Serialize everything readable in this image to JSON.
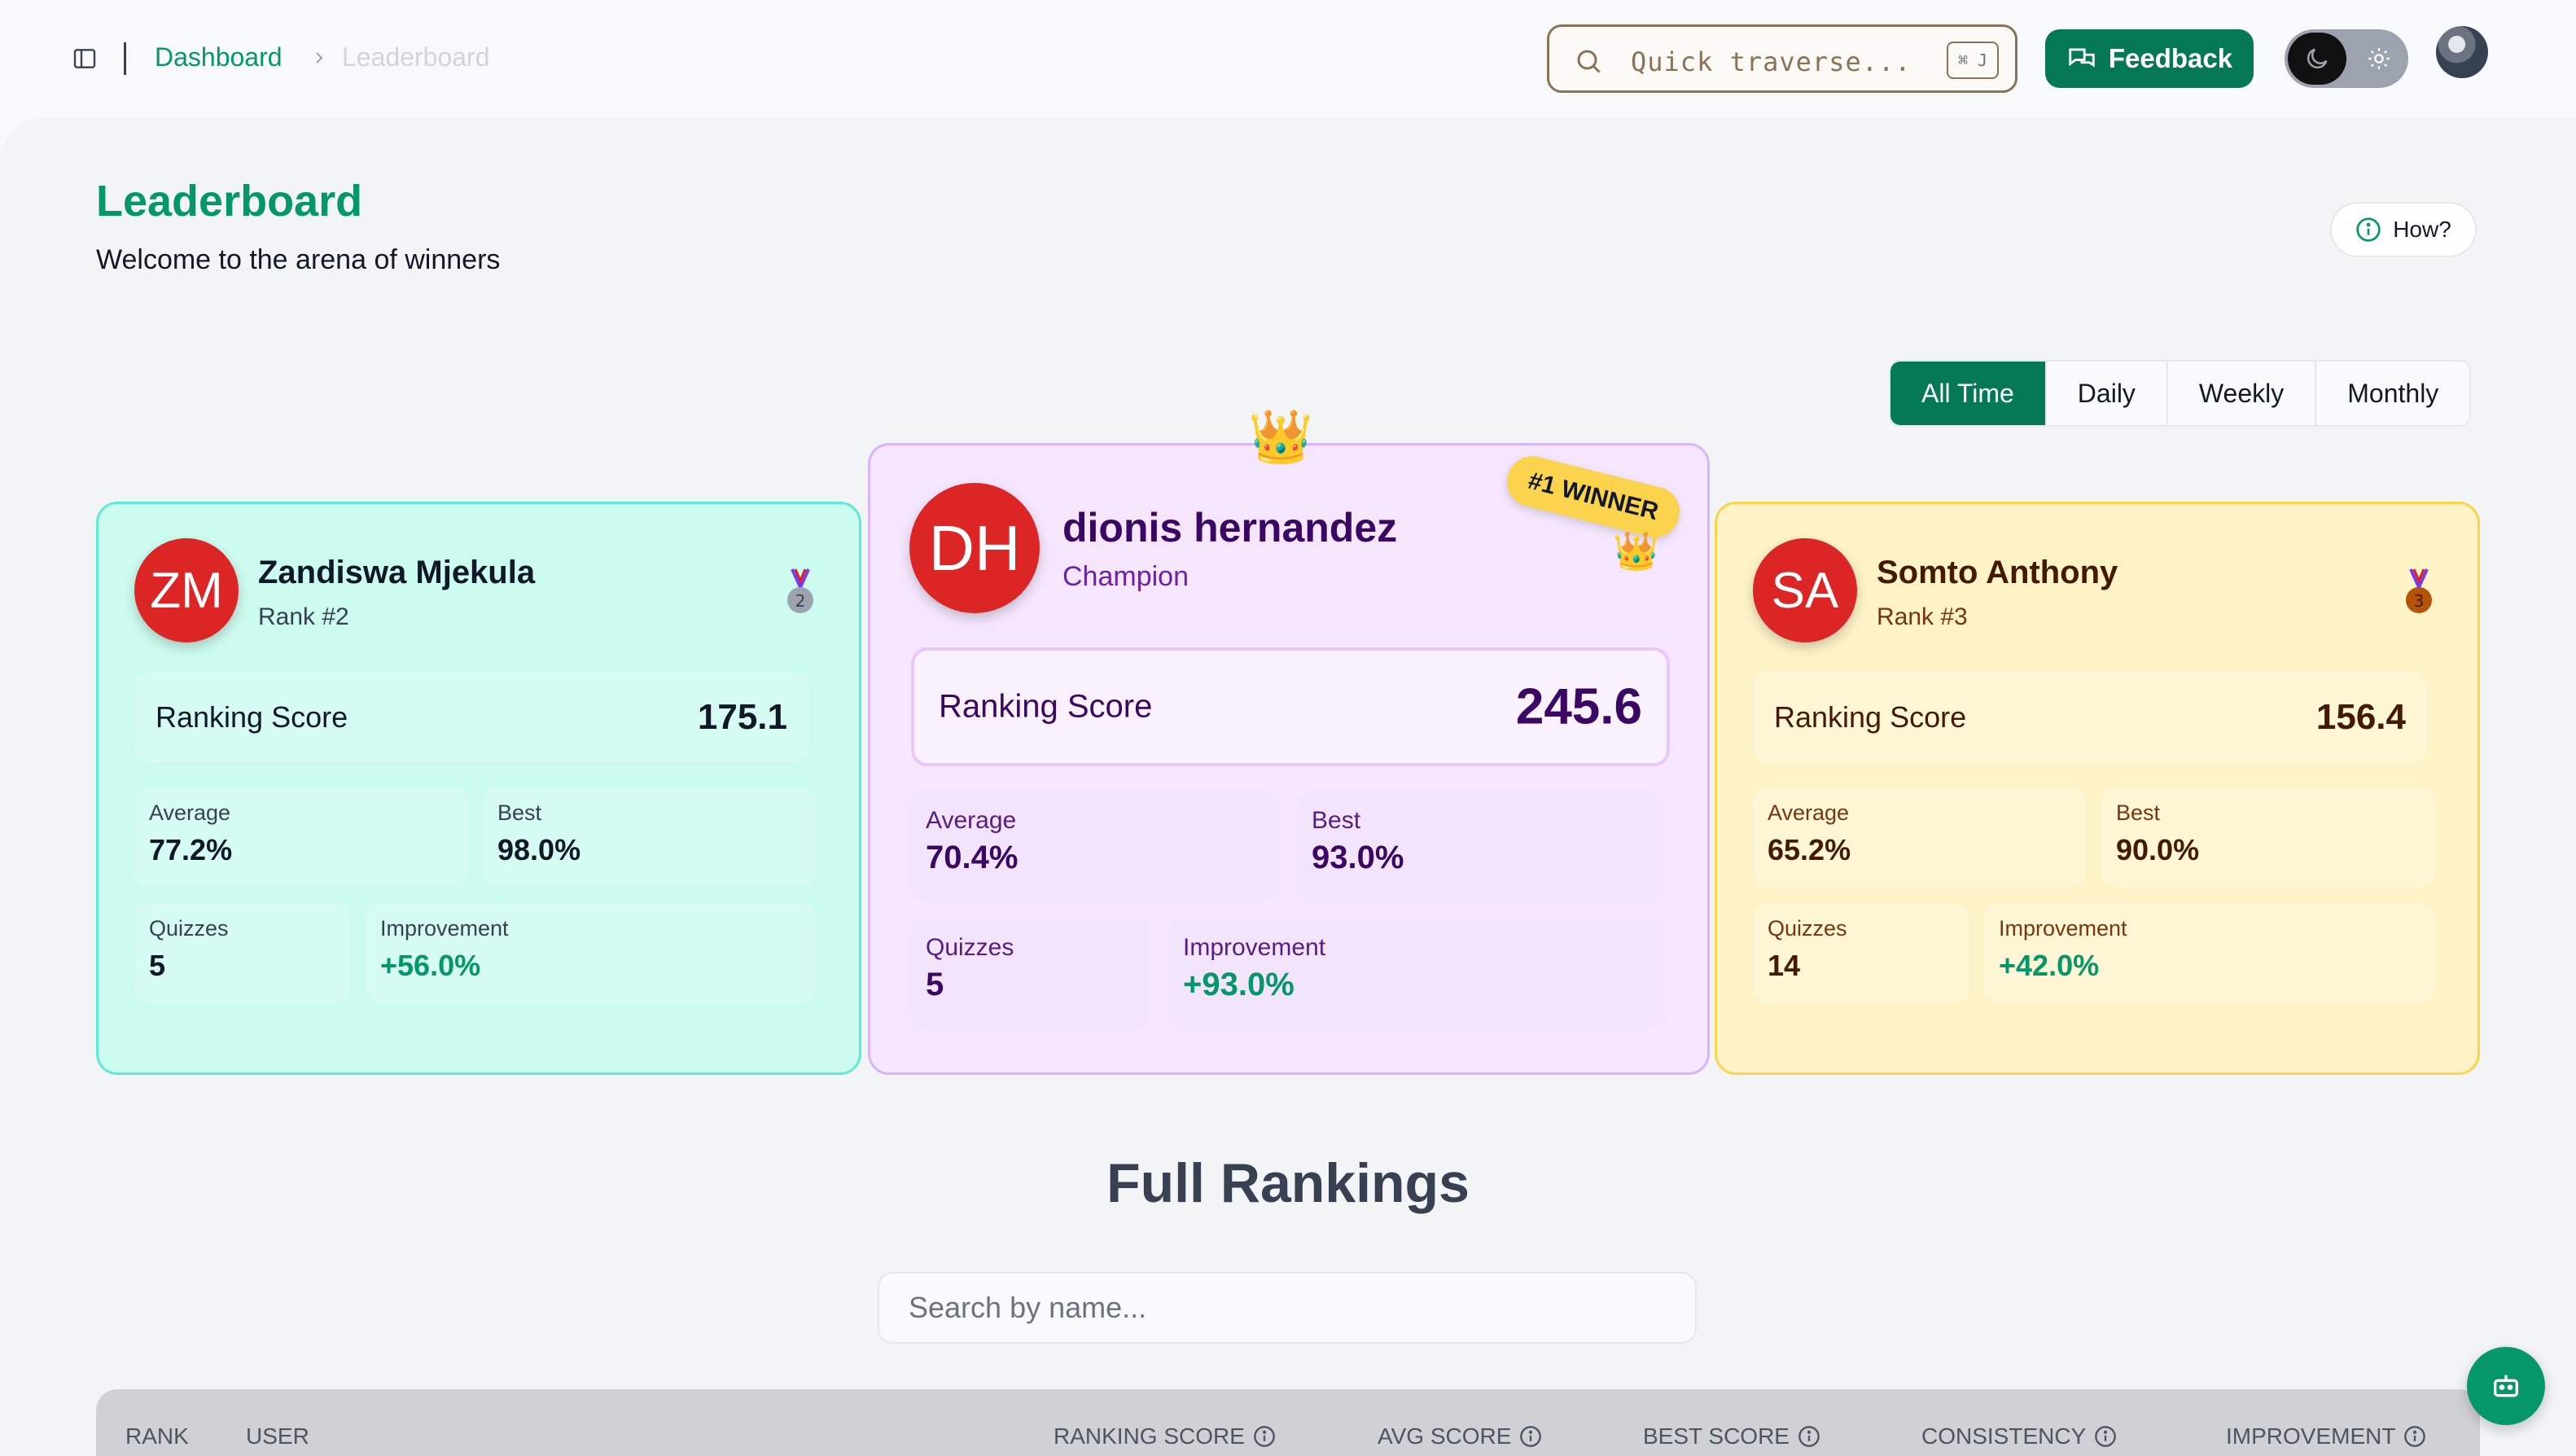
{
  "breadcrumb": {
    "root": "Dashboard",
    "current": "Leaderboard"
  },
  "search": {
    "placeholder": "Quick traverse...",
    "shortcut": "⌘ J"
  },
  "header": {
    "feedback_label": "Feedback"
  },
  "page": {
    "title": "Leaderboard",
    "subtitle": "Welcome to the arena of winners",
    "how_label": "How?"
  },
  "filters": [
    {
      "label": "All Time",
      "active": true
    },
    {
      "label": "Daily",
      "active": false
    },
    {
      "label": "Weekly",
      "active": false
    },
    {
      "label": "Monthly",
      "active": false
    }
  ],
  "podium": {
    "first": {
      "initials": "DH",
      "name": "dionis hernandez",
      "subtitle": "Champion",
      "badge": "#1 WINNER",
      "score_label": "Ranking Score",
      "score": "245.6",
      "average_label": "Average",
      "average": "70.4%",
      "best_label": "Best",
      "best": "93.0%",
      "quizzes_label": "Quizzes",
      "quizzes": "5",
      "improvement_label": "Improvement",
      "improvement": "+93.0%"
    },
    "second": {
      "initials": "ZM",
      "name": "Zandiswa Mjekula",
      "subtitle": "Rank #2",
      "score_label": "Ranking Score",
      "score": "175.1",
      "average_label": "Average",
      "average": "77.2%",
      "best_label": "Best",
      "best": "98.0%",
      "quizzes_label": "Quizzes",
      "quizzes": "5",
      "improvement_label": "Improvement",
      "improvement": "+56.0%",
      "medal_number": "2"
    },
    "third": {
      "initials": "SA",
      "name": "Somto Anthony",
      "subtitle": "Rank #3",
      "score_label": "Ranking Score",
      "score": "156.4",
      "average_label": "Average",
      "average": "65.2%",
      "best_label": "Best",
      "best": "90.0%",
      "quizzes_label": "Quizzes",
      "quizzes": "14",
      "improvement_label": "Improvement",
      "improvement": "+42.0%",
      "medal_number": "3"
    }
  },
  "rankings": {
    "title": "Full Rankings",
    "search_placeholder": "Search by name...",
    "columns": [
      "RANK",
      "USER",
      "RANKING SCORE",
      "AVG SCORE",
      "BEST SCORE",
      "CONSISTENCY",
      "IMPROVEMENT"
    ]
  },
  "colors": {
    "accent": "#059669",
    "accent_dark": "#047857",
    "avatar": "#dc2626"
  },
  "icons": [
    "sidebar-toggle-icon",
    "chevron-right-icon",
    "search-icon",
    "feedback-icon",
    "moon-icon",
    "sun-icon",
    "info-icon",
    "crown-icon",
    "medal-icon",
    "bot-icon"
  ]
}
